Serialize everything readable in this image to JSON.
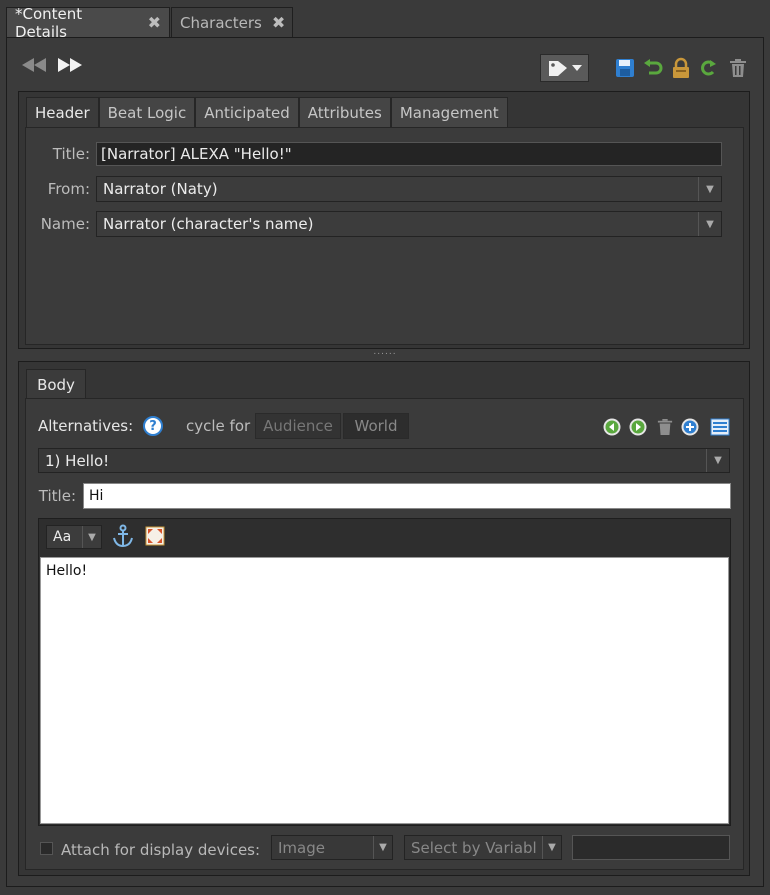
{
  "window_tabs": [
    {
      "label": "*Content Details",
      "close": "✖"
    },
    {
      "label": "Characters",
      "close": "✖"
    }
  ],
  "header_tabs": [
    "Header",
    "Beat Logic",
    "Anticipated",
    "Attributes",
    "Management"
  ],
  "header": {
    "title_label": "Title:",
    "title_value": "[Narrator] ALEXA \"Hello!\"",
    "from_label": "From:",
    "from_value": "Narrator (Naty)",
    "name_label": "Name:",
    "name_value": "Narrator  (character's name)"
  },
  "splitter": "......",
  "body_tab": "Body",
  "body": {
    "alternatives_label": "Alternatives:",
    "help": "?",
    "cycle_label": "cycle for",
    "cycle_audience": "Audience",
    "cycle_world": "World",
    "alt_selected": "1) Hello!",
    "title_label": "Title:",
    "title_value": "Hi",
    "font_button": "Aa",
    "text_content": "Hello!",
    "attach_label": "Attach for display devices:",
    "image_select": "Image",
    "variable_select": "Select by Variabl"
  },
  "colors": {
    "accent_blue": "#2f7fd0",
    "accent_green": "#5aa83e",
    "lock_gold": "#c9973a"
  }
}
